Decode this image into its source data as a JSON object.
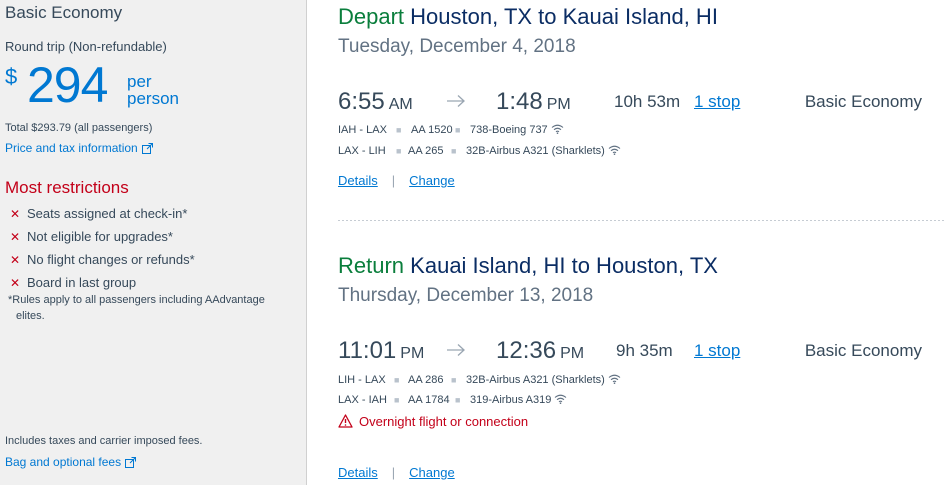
{
  "sidebar": {
    "title": "Basic Economy",
    "fare_type": "Round trip (Non-refundable)",
    "currency": "$",
    "amount": "294",
    "per_person": "per person",
    "total": "Total $293.79 (all passengers)",
    "price_tax_link": "Price and tax information",
    "restrictions_heading": "Most restrictions",
    "restrictions": [
      "Seats assigned at check-in*",
      "Not eligible for upgrades*",
      "No flight changes or refunds*",
      "Board in last group"
    ],
    "restrictions_note_line1": "*Rules apply to all passengers including AAdvantage",
    "restrictions_note_line2": "elites.",
    "includes_taxes": "Includes taxes and carrier imposed fees.",
    "bag_fees_link": "Bag and optional fees",
    "accent_color": "#0078d2",
    "restriction_color": "#c30019"
  },
  "depart": {
    "direction": "Depart",
    "route": "Houston, TX to Kauai Island, HI",
    "date": "Tuesday, December 4, 2018",
    "depart_time": "6:55",
    "depart_ampm": "AM",
    "arrive_time": "1:48",
    "arrive_ampm": "PM",
    "duration": "10h  53m",
    "stops": "1 stop",
    "cabin": "Basic Economy",
    "legs": [
      {
        "route": "IAH - LAX",
        "flight": "AA 1520",
        "aircraft": "738-Boeing 737"
      },
      {
        "route": "LAX - LIH",
        "flight": "AA 265",
        "aircraft": "32B-Airbus A321 (Sharklets)"
      }
    ],
    "details_link": "Details",
    "separator": "|",
    "change_link": "Change"
  },
  "return": {
    "direction": "Return",
    "route": "Kauai Island, HI to Houston, TX",
    "date": "Thursday, December 13, 2018",
    "depart_time": "11:01",
    "depart_ampm": "PM",
    "arrive_time": "12:36",
    "arrive_ampm": "PM",
    "duration": "9h  35m",
    "stops": "1 stop",
    "cabin": "Basic Economy",
    "legs": [
      {
        "route": "LIH - LAX",
        "flight": "AA 286",
        "aircraft": "32B-Airbus A321 (Sharklets)"
      },
      {
        "route": "LAX - IAH",
        "flight": "AA 1784",
        "aircraft": "319-Airbus A319"
      }
    ],
    "warning": "Overnight flight or connection",
    "details_link": "Details",
    "separator": "|",
    "change_link": "Change"
  },
  "icons": {
    "arrow": "arrow-right-icon",
    "wifi": "wifi-icon",
    "external": "external-link-icon",
    "restriction": "x-icon",
    "warning": "warning-triangle-icon"
  },
  "colors": {
    "depart_green": "#0a7e3c",
    "heading_navy": "#0b2d64",
    "link_blue": "#0078d2",
    "warning_red": "#c30019"
  }
}
